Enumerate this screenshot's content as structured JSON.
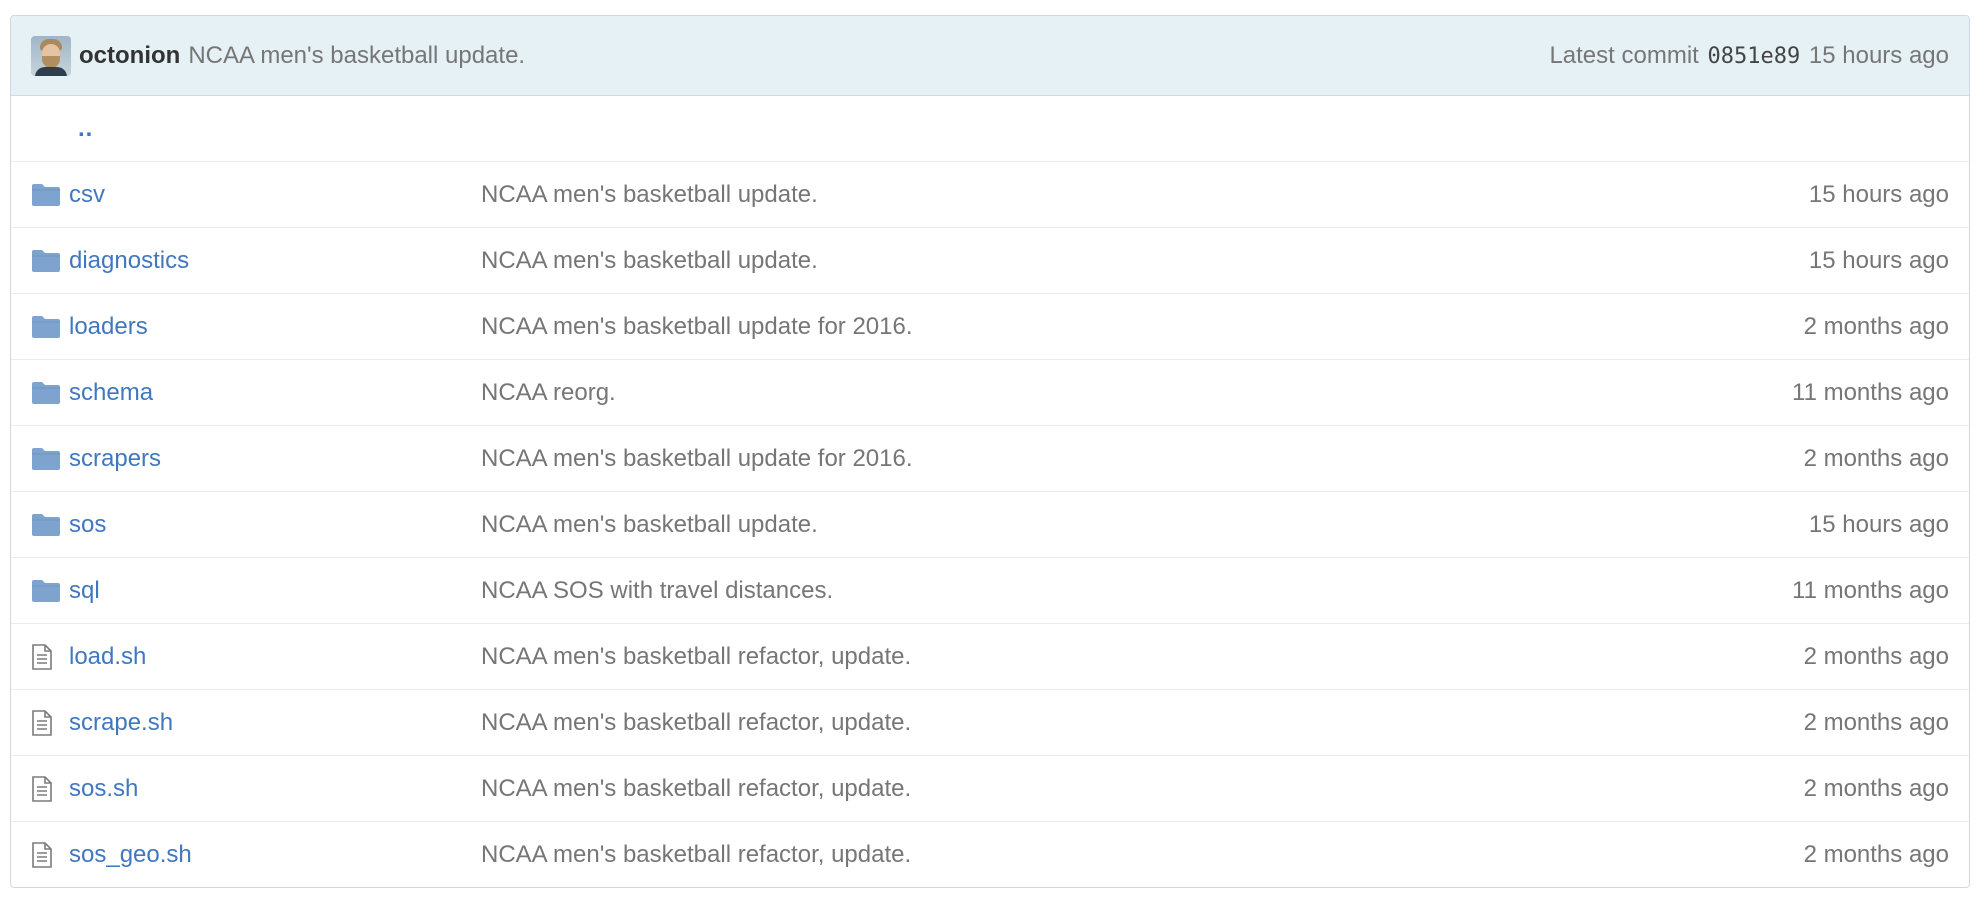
{
  "commit": {
    "author": "octonion",
    "message": "NCAA men's basketball update.",
    "latest_label": "Latest commit",
    "sha": "0851e89",
    "age": "15 hours ago"
  },
  "parent_link": "..",
  "files": [
    {
      "type": "directory",
      "icon": "folder-icon",
      "name": "csv",
      "message": "NCAA men's basketball update.",
      "age": "15 hours ago"
    },
    {
      "type": "directory",
      "icon": "folder-icon",
      "name": "diagnostics",
      "message": "NCAA men's basketball update.",
      "age": "15 hours ago"
    },
    {
      "type": "directory",
      "icon": "folder-icon",
      "name": "loaders",
      "message": "NCAA men's basketball update for 2016.",
      "age": "2 months ago"
    },
    {
      "type": "directory",
      "icon": "folder-icon",
      "name": "schema",
      "message": "NCAA reorg.",
      "age": "11 months ago"
    },
    {
      "type": "directory",
      "icon": "folder-icon",
      "name": "scrapers",
      "message": "NCAA men's basketball update for 2016.",
      "age": "2 months ago"
    },
    {
      "type": "directory",
      "icon": "folder-icon",
      "name": "sos",
      "message": "NCAA men's basketball update.",
      "age": "15 hours ago"
    },
    {
      "type": "directory",
      "icon": "folder-icon",
      "name": "sql",
      "message": "NCAA SOS with travel distances.",
      "age": "11 months ago"
    },
    {
      "type": "file",
      "icon": "file-icon",
      "name": "load.sh",
      "message": "NCAA men's basketball refactor, update.",
      "age": "2 months ago"
    },
    {
      "type": "file",
      "icon": "file-icon",
      "name": "scrape.sh",
      "message": "NCAA men's basketball refactor, update.",
      "age": "2 months ago"
    },
    {
      "type": "file",
      "icon": "file-icon",
      "name": "sos.sh",
      "message": "NCAA men's basketball refactor, update.",
      "age": "2 months ago"
    },
    {
      "type": "file",
      "icon": "file-icon",
      "name": "sos_geo.sh",
      "message": "NCAA men's basketball refactor, update.",
      "age": "2 months ago"
    }
  ],
  "colors": {
    "link": "#4078c0",
    "folder": "#7fa3cf",
    "header_bg": "#e6f1f6",
    "muted_text": "#767676"
  }
}
